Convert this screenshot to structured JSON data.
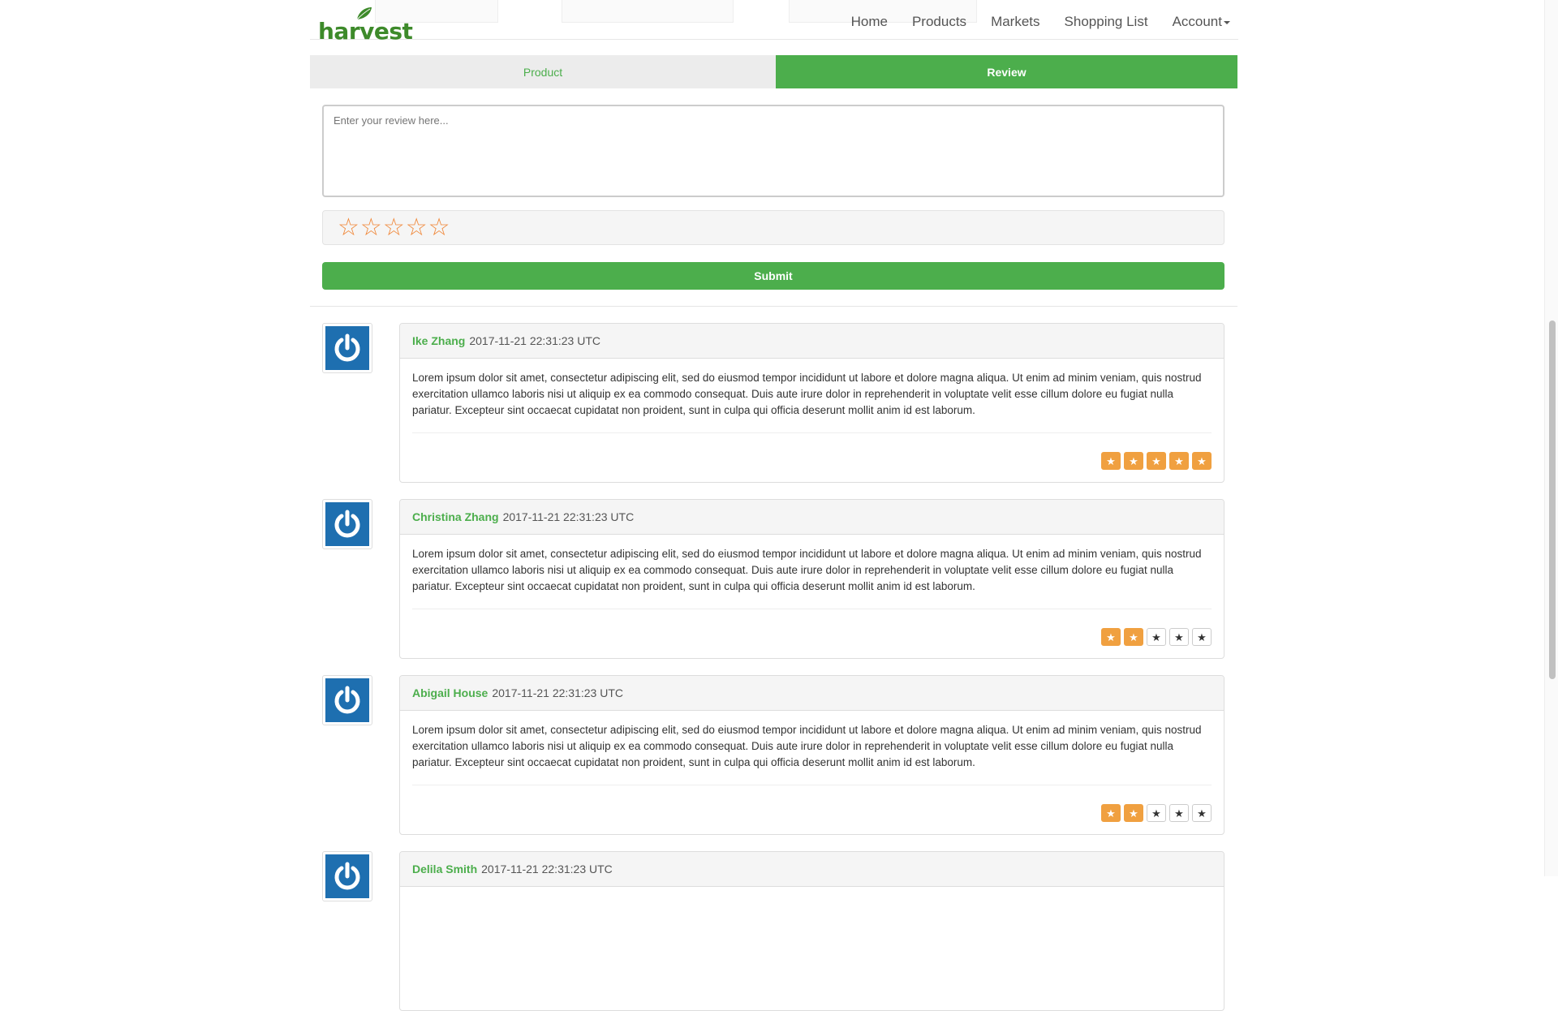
{
  "brand": {
    "name": "harvest",
    "accent": "#4cae4c",
    "logo_color": "#3d8a2a"
  },
  "nav": {
    "items": [
      "Home",
      "Products",
      "Markets",
      "Shopping List",
      "Account"
    ]
  },
  "tabs": {
    "product": "Product",
    "review": "Review",
    "active": "Review"
  },
  "form": {
    "placeholder": "Enter your review here...",
    "value": "",
    "rating_icon": "empty-star-icon",
    "rating_value": 0,
    "rating_max": 5,
    "rating_color": "#f0883a",
    "submit_label": "Submit"
  },
  "reviews": [
    {
      "author": "Ike Zhang",
      "timestamp": "2017-11-21 22:31:23 UTC",
      "body": "Lorem ipsum dolor sit amet, consectetur adipiscing elit, sed do eiusmod tempor incididunt ut labore et dolore magna aliqua. Ut enim ad minim veniam, quis nostrud exercitation ullamco laboris nisi ut aliquip ex ea commodo consequat. Duis aute irure dolor in reprehenderit in voluptate velit esse cillum dolore eu fugiat nulla pariatur. Excepteur sint occaecat cupidatat non proident, sunt in culpa qui officia deserunt mollit anim id est laborum.",
      "rating": 5,
      "avatar_icon": "power-icon"
    },
    {
      "author": "Christina Zhang",
      "timestamp": "2017-11-21 22:31:23 UTC",
      "body": "Lorem ipsum dolor sit amet, consectetur adipiscing elit, sed do eiusmod tempor incididunt ut labore et dolore magna aliqua. Ut enim ad minim veniam, quis nostrud exercitation ullamco laboris nisi ut aliquip ex ea commodo consequat. Duis aute irure dolor in reprehenderit in voluptate velit esse cillum dolore eu fugiat nulla pariatur. Excepteur sint occaecat cupidatat non proident, sunt in culpa qui officia deserunt mollit anim id est laborum.",
      "rating": 2,
      "avatar_icon": "power-icon"
    },
    {
      "author": "Abigail House",
      "timestamp": "2017-11-21 22:31:23 UTC",
      "body": "Lorem ipsum dolor sit amet, consectetur adipiscing elit, sed do eiusmod tempor incididunt ut labore et dolore magna aliqua. Ut enim ad minim veniam, quis nostrud exercitation ullamco laboris nisi ut aliquip ex ea commodo consequat. Duis aute irure dolor in reprehenderit in voluptate velit esse cillum dolore eu fugiat nulla pariatur. Excepteur sint occaecat cupidatat non proident, sunt in culpa qui officia deserunt mollit anim id est laborum.",
      "rating": 2,
      "avatar_icon": "power-icon"
    },
    {
      "author": "Delila Smith",
      "timestamp": "2017-11-21 22:31:23 UTC",
      "body": "",
      "rating": null,
      "avatar_icon": "power-icon"
    }
  ],
  "rating_colors": {
    "filled": "#f0a040",
    "empty": "#ffffff"
  }
}
